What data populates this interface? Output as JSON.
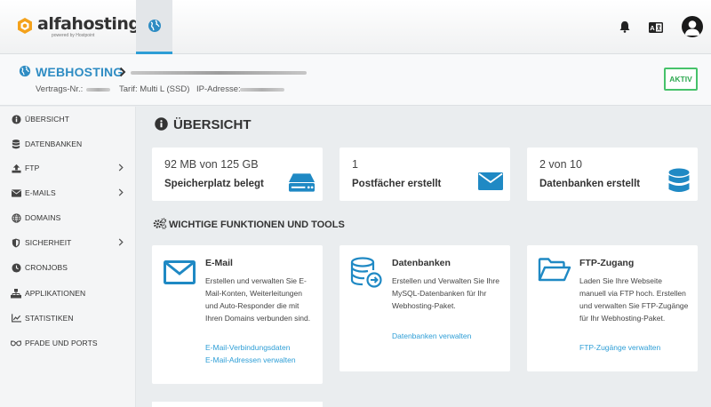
{
  "brand": {
    "name": "alfahosting",
    "tagline": "powered by Hostpoint"
  },
  "header": {
    "section_title": "WEBHOSTING",
    "contract_label": "Vertrags-Nr.:",
    "tariff": "Tarif: Multi L (SSD)",
    "ip_label": "IP-Adresse:",
    "status": "AKTIV",
    "status_color": "#46c26a"
  },
  "language_badge": "A",
  "sidebar": {
    "items": [
      {
        "label": "ÜBERSICHT",
        "icon": "info-icon",
        "has_submenu": false
      },
      {
        "label": "DATENBANKEN",
        "icon": "database-icon",
        "has_submenu": false
      },
      {
        "label": "FTP",
        "icon": "upload-icon",
        "has_submenu": true
      },
      {
        "label": "E-MAILS",
        "icon": "envelope-icon",
        "has_submenu": true
      },
      {
        "label": "DOMAINS",
        "icon": "globe-icon",
        "has_submenu": false
      },
      {
        "label": "SICHERHEIT",
        "icon": "shield-icon",
        "has_submenu": true
      },
      {
        "label": "CRONJOBS",
        "icon": "clock-icon",
        "has_submenu": false
      },
      {
        "label": "APPLIKATIONEN",
        "icon": "sitemap-icon",
        "has_submenu": false
      },
      {
        "label": "STATISTIKEN",
        "icon": "chart-icon",
        "has_submenu": false
      },
      {
        "label": "PFADE UND PORTS",
        "icon": "glasses-icon",
        "has_submenu": false
      }
    ]
  },
  "main": {
    "title": "ÜBERSICHT",
    "stats": [
      {
        "value": "92 MB von 125 GB",
        "label": "Speicherplatz belegt",
        "icon": "hdd-icon"
      },
      {
        "value": "1",
        "label": "Postfächer erstellt",
        "icon": "envelope-icon"
      },
      {
        "value": "2 von 10",
        "label": "Datenbanken erstellt",
        "icon": "database-icon"
      }
    ],
    "tools_title": "WICHTIGE FUNKTIONEN UND TOOLS",
    "tools": [
      {
        "title": "E-Mail",
        "description": "Erstellen und verwalten Sie E-Mail-Konten, Weiterleitungen und Auto-Responder die mit Ihren Domains verbunden sind.",
        "links": [
          "E-Mail-Verbindungsdaten",
          "E-Mail-Adressen verwalten"
        ]
      },
      {
        "title": "Datenbanken",
        "description": "Erstellen und Verwalten Sie Ihre MySQL-Datenbanken für Ihr Webhosting-Paket.",
        "links": [
          "Datenbanken verwalten"
        ]
      },
      {
        "title": "FTP-Zugang",
        "description": "Laden Sie Ihre Webseite manuell via FTP hoch. Erstellen und verwalten Sie FTP-Zugänge für Ihr Webhosting-Paket.",
        "links": [
          "FTP-Zugänge verwalten"
        ]
      }
    ]
  },
  "colors": {
    "accent": "#2e9ed6",
    "title_blue": "#2e8cc3",
    "icon_blue": "#1f89c4"
  }
}
